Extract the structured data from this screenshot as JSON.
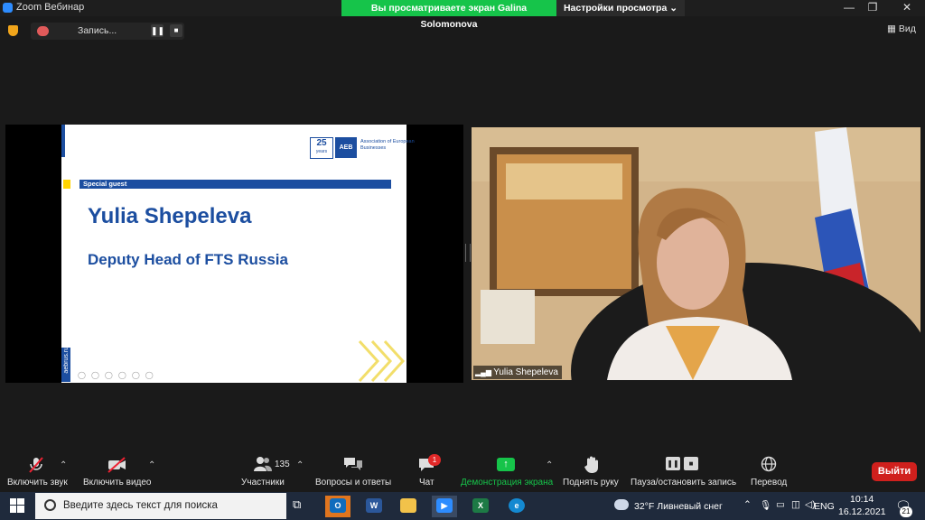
{
  "window": {
    "title": "Zoom Вебинар",
    "share_banner": "Вы просматриваете экран Galina Solomonova",
    "view_options": "Настройки просмотра ⌄",
    "min": "—",
    "max": "❐",
    "close": "✕"
  },
  "recording": {
    "label": "Запись...",
    "pause": "❚❚",
    "stop": "■"
  },
  "view_button": "Вид",
  "slide": {
    "years": "25",
    "years_sub": "years",
    "org_logo": "AEB",
    "org_name": "Association of European Businesses",
    "badge": "Special guest",
    "speaker": "Yulia Shepeleva",
    "position": "Deputy Head of FTS Russia",
    "side_url": "aebrus.ru"
  },
  "participant": {
    "name": "Yulia Shepeleva"
  },
  "toolbar": {
    "audio": "Включить звук",
    "video": "Включить видео",
    "participants_count": "135",
    "participants": "Участники",
    "qa": "Вопросы и ответы",
    "chat": "Чат",
    "chat_badge": "1",
    "share": "Демонстрация экрана",
    "raise_hand": "Поднять руку",
    "record": "Пауза/остановить запись",
    "translate": "Перевод",
    "leave": "Выйти"
  },
  "taskbar": {
    "search_placeholder": "Введите здесь текст для поиска",
    "weather": "32°F  Ливневый снег",
    "lang": "ENG",
    "time": "10:14",
    "date": "16.12.2021",
    "notifications": "21"
  },
  "colors": {
    "accent": "#1c4ea0",
    "share_green": "#16c44a",
    "leave_red": "#d0201d"
  }
}
